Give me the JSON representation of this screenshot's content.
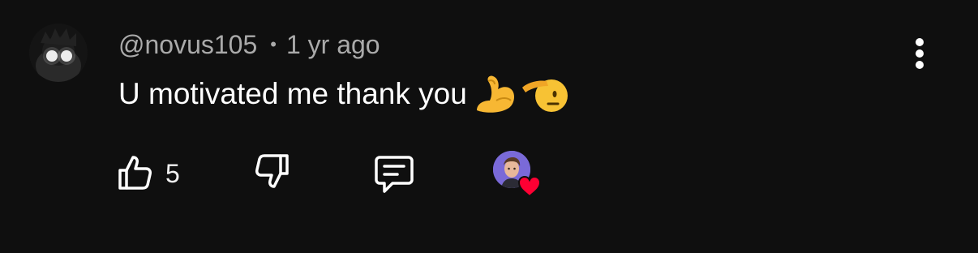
{
  "comment": {
    "author_handle": "@novus105",
    "separator": "•",
    "timestamp": "1 yr ago",
    "text": "U motivated me thank you",
    "emojis": [
      "flexed-biceps-emoji",
      "saluting-face-emoji"
    ]
  },
  "actions": {
    "like_count": "5",
    "like_icon": "thumbs-up-icon",
    "dislike_icon": "thumbs-down-icon",
    "reply_icon": "reply-bubble-icon",
    "creator_heart_icon": "heart-icon"
  },
  "colors": {
    "background": "#0f0f0f",
    "meta_text": "#aaaaaa",
    "body_text": "#ffffff",
    "heart": "#ff0033",
    "creator_avatar_bg": "#7a6ad8"
  }
}
